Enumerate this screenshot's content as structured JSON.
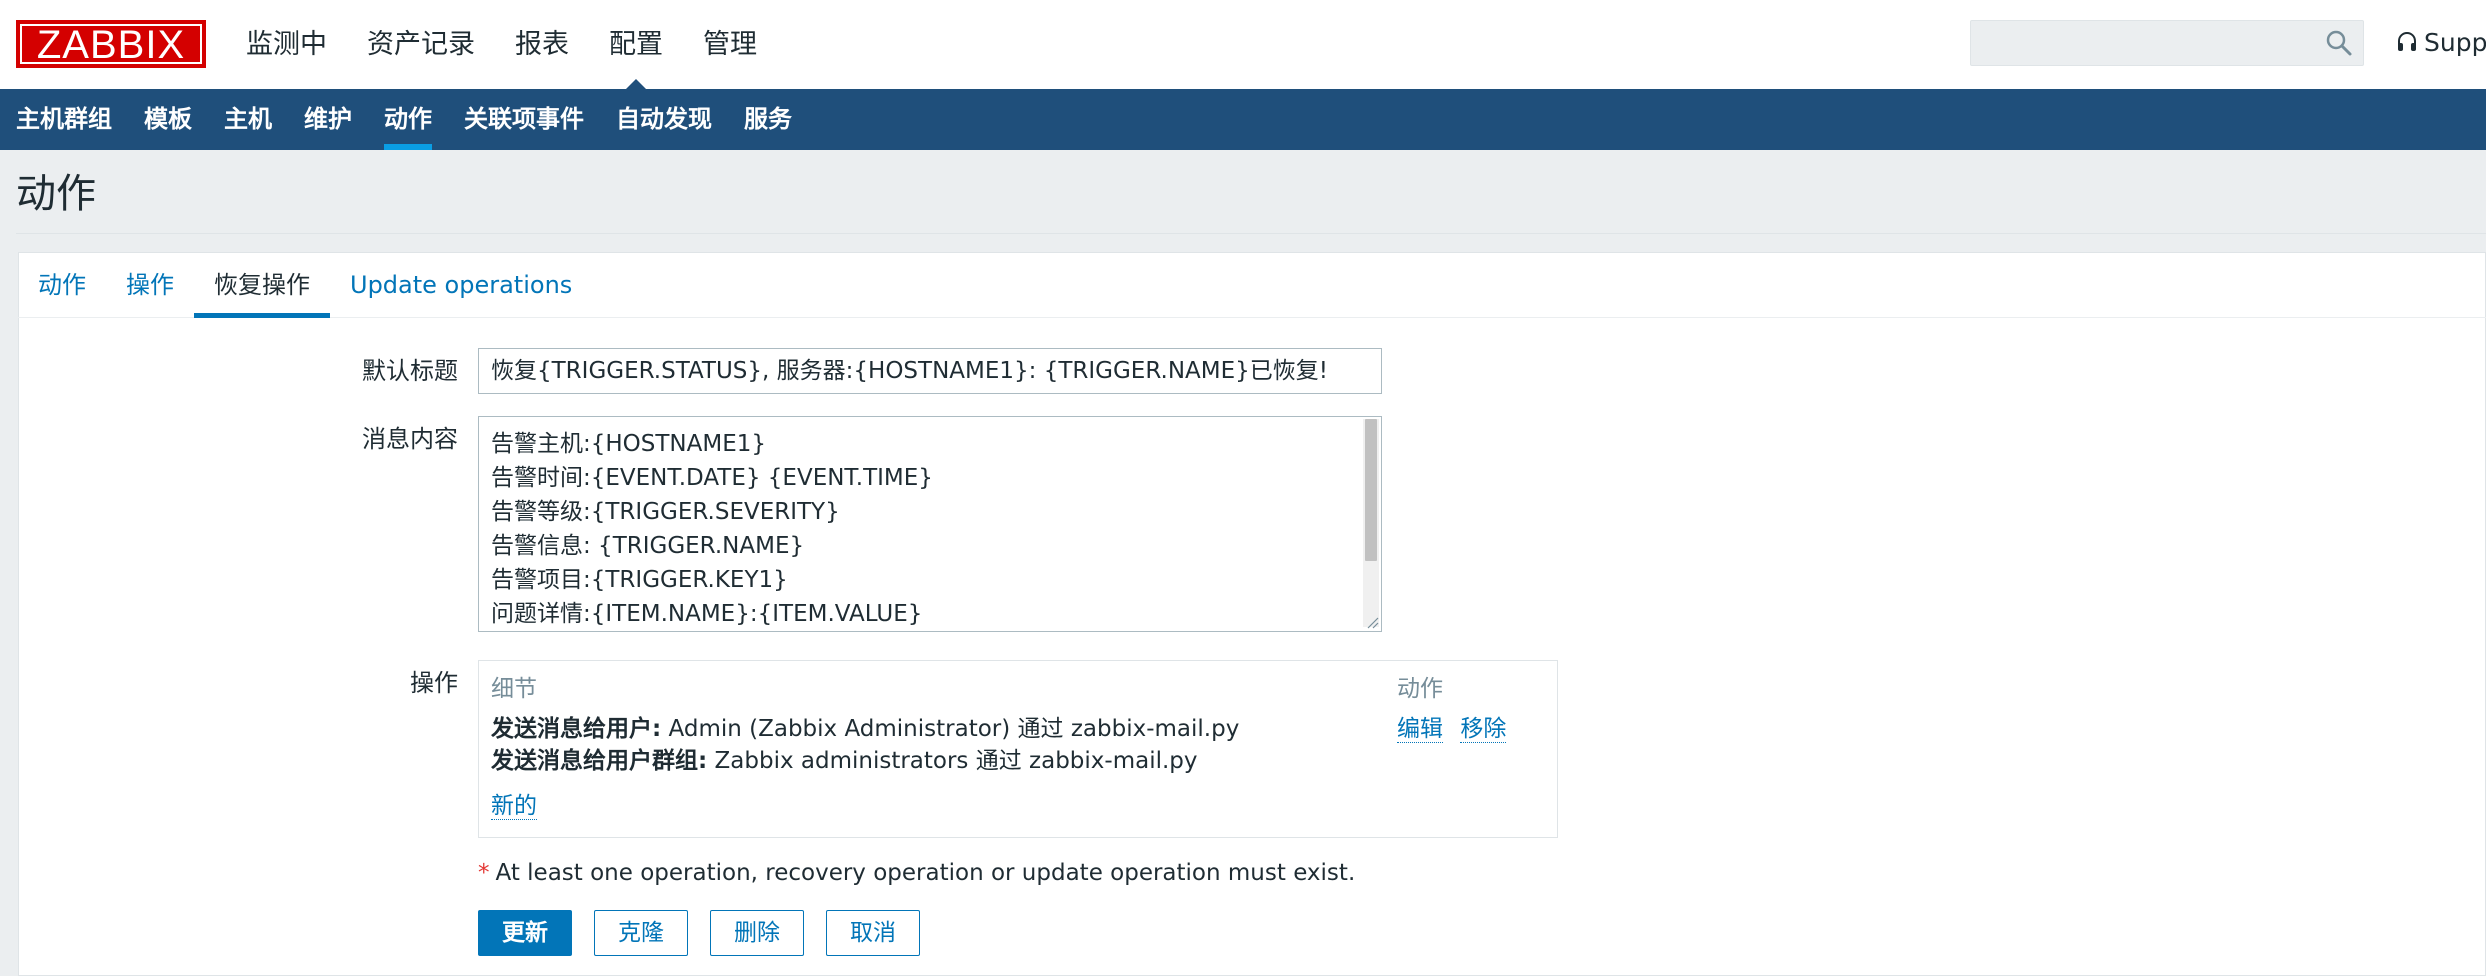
{
  "brand": {
    "logo_text": "ZABBIX",
    "accent": "#d40000",
    "nav_bg": "#1f4f7b",
    "link": "#0275b8"
  },
  "top_menu": [
    {
      "label": "监测中"
    },
    {
      "label": "资产记录"
    },
    {
      "label": "报表"
    },
    {
      "label": "配置",
      "active": true
    },
    {
      "label": "管理"
    }
  ],
  "search": {
    "placeholder": "",
    "icon": "search-icon"
  },
  "support": {
    "label": "Support",
    "icon": "headset-icon"
  },
  "sub_menu": [
    {
      "label": "主机群组"
    },
    {
      "label": "模板"
    },
    {
      "label": "主机"
    },
    {
      "label": "维护"
    },
    {
      "label": "动作",
      "active": true
    },
    {
      "label": "关联项事件"
    },
    {
      "label": "自动发现"
    },
    {
      "label": "服务"
    }
  ],
  "page": {
    "title": "动作"
  },
  "tabs": [
    {
      "label": "动作"
    },
    {
      "label": "操作"
    },
    {
      "label": "恢复操作",
      "active": true
    },
    {
      "label": "Update operations"
    }
  ],
  "form": {
    "subject_label": "默认标题",
    "subject_value": "恢复{TRIGGER.STATUS}, 服务器:{HOSTNAME1}: {TRIGGER.NAME}已恢复!",
    "message_label": "消息内容",
    "message_lines": [
      "告警主机:{HOSTNAME1}",
      "告警时间:{EVENT.DATE} {EVENT.TIME}",
      "告警等级:{TRIGGER.SEVERITY}",
      "告警信息: {TRIGGER.NAME}",
      "告警项目:{TRIGGER.KEY1}",
      "问题详情:{ITEM.NAME}:{ITEM.VALUE}"
    ],
    "operations_label": "操作",
    "operations": {
      "col_details": "细节",
      "col_actions": "动作",
      "rows": [
        {
          "prefix": "发送消息给用户:",
          "text": " Admin (Zabbix Administrator) 通过 zabbix-mail.py"
        },
        {
          "prefix": "发送消息给用户群组:",
          "text": " Zabbix administrators 通过 zabbix-mail.py"
        }
      ],
      "edit_label": "编辑",
      "remove_label": "移除",
      "new_label": "新的"
    },
    "required_star": "*",
    "required_note": "At least one operation, recovery operation or update operation must exist."
  },
  "buttons": {
    "update": "更新",
    "clone": "克隆",
    "delete": "删除",
    "cancel": "取消"
  }
}
